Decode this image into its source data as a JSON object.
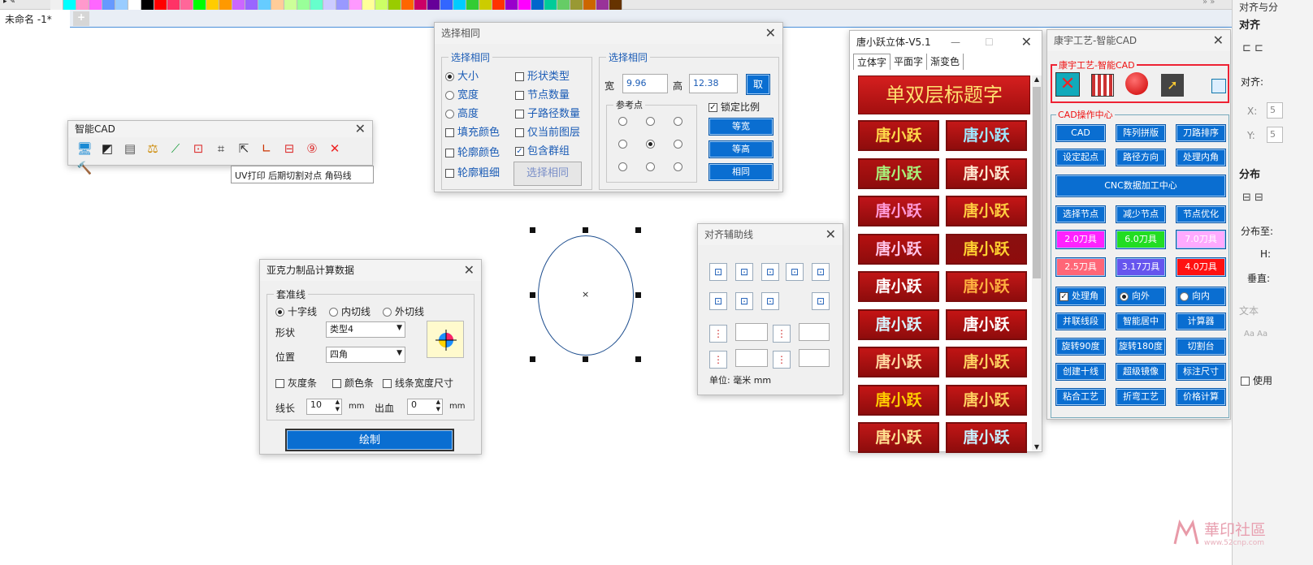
{
  "palette": [
    "#f0f0f0",
    "#00ffff",
    "#ff99cc",
    "#ff66ff",
    "#6699ff",
    "#99ccff",
    "#ffffff",
    "#000000",
    "#ff0000",
    "#ff3366",
    "#ff6699",
    "#00ff00",
    "#ffcc00",
    "#ff9900",
    "#cc66ff",
    "#9966ff",
    "#66ccff",
    "#ffcc99",
    "#ccff99",
    "#99ff99",
    "#66ffcc",
    "#ccccff",
    "#9999ff",
    "#ff99ff",
    "#ffff99",
    "#ccff66",
    "#99cc00",
    "#ff6600",
    "#cc0066",
    "#660099",
    "#3366ff",
    "#00ccff",
    "#33cc33",
    "#cccc00",
    "#ff3300",
    "#9900cc",
    "#ff00ff",
    "#0066cc",
    "#00cc99",
    "#66cc66",
    "#999933",
    "#cc6600",
    "#993399",
    "#663300"
  ],
  "tab": {
    "title": "未命名 -1*",
    "add": "+"
  },
  "smart": {
    "title": "智能CAD",
    "tooltip": "UV打印 后期切割对点 角码线",
    "icons": [
      "monitor-icon",
      "edit-shape-icon",
      "table-icon",
      "scale-icon",
      "node-curve-icon",
      "crop-marks-icon",
      "frame-icon",
      "pointer-icon",
      "corner-icon",
      "split-icon",
      "rotate-90-icon",
      "cross-fill-icon",
      "hammer-icon"
    ]
  },
  "same": {
    "title": "选择相同",
    "group1": "选择相同",
    "col1": [
      "大小",
      "宽度",
      "高度",
      "填充颜色",
      "轮廓颜色",
      "轮廓粗细"
    ],
    "col2": [
      "形状类型",
      "节点数量",
      "子路径数量",
      "仅当前图层",
      "包含群组"
    ],
    "select_btn": "选择相同",
    "group2": "选择相同",
    "w_label": "宽",
    "w": "9.96",
    "h_label": "高",
    "h": "12.38",
    "take": "取",
    "ref": "参考点",
    "lock": "锁定比例",
    "eq_w": "等宽",
    "eq_h": "等高",
    "same": "相同"
  },
  "acrylic": {
    "title": "亚克力制品计算数据",
    "group": "套准线",
    "r1": "十字线",
    "r2": "内切线",
    "r3": "外切线",
    "shape_l": "形状",
    "shape_v": "类型4",
    "pos_l": "位置",
    "pos_v": "四角",
    "c1": "灰度条",
    "c2": "颜色条",
    "c3": "线条宽度尺寸",
    "len_l": "线长",
    "len_v": "10",
    "unit": "mm",
    "bleed_l": "出血",
    "bleed_v": "0",
    "draw": "绘制"
  },
  "align": {
    "title": "对齐辅助线",
    "unit": "单位: 毫米 mm"
  },
  "tang": {
    "title": "唐小跃立体-V5.1",
    "tabs": [
      "立体字",
      "平面字",
      "渐变色"
    ],
    "banner": "单双层标题字",
    "tile": "唐小跃",
    "tiles": [
      [
        "#b81414",
        "#ffd84a"
      ],
      [
        "#c41818",
        "#9fe8ff"
      ],
      [
        "#b01212",
        "#a8f07a"
      ],
      [
        "#c21616",
        "#ffe7d0"
      ],
      [
        "#c0141a",
        "#ff9ad8"
      ],
      [
        "#c41616",
        "#ffcc40"
      ],
      [
        "#b51010",
        "#ffc4e8"
      ],
      [
        "#8a1010",
        "#ffd030"
      ],
      [
        "#c01616",
        "#ffffff"
      ],
      [
        "#c21818",
        "#ffb040"
      ],
      [
        "#c41414",
        "#d8f4ff"
      ],
      [
        "#c41414",
        "#ffffff"
      ],
      [
        "#c41616",
        "#ffd6a0"
      ],
      [
        "#c01414",
        "#ffd060"
      ],
      [
        "#c41616",
        "#ffcc00"
      ],
      [
        "#c41616",
        "#ffd060"
      ],
      [
        "#c01818",
        "#ffe090"
      ],
      [
        "#c01616",
        "#c8f0ff"
      ]
    ]
  },
  "kang": {
    "title": "康宇工艺-智能CAD",
    "sec1": "康宇工艺-智能CAD",
    "sec2": "CAD操作中心",
    "btn_cad": "CAD",
    "btn_tile": "阵列拼版",
    "btn_sort": "刀路排序",
    "r2": [
      "设定起点",
      "路径方向",
      "处理内角"
    ],
    "cnc": "CNC数据加工中心",
    "r3": [
      "选择节点",
      "减少节点",
      "节点优化"
    ],
    "knives": [
      {
        "t": "2.0刀具",
        "bg": "#ff22ff",
        "c": "#fff"
      },
      {
        "t": "6.0刀具",
        "bg": "#22dd22",
        "c": "#fff"
      },
      {
        "t": "7.0刀具",
        "bg": "#ffaaff",
        "c": "#fff"
      },
      {
        "t": "2.5刀具",
        "bg": "#ff6677",
        "c": "#fff"
      },
      {
        "t": "3.17刀具",
        "bg": "#6655ee",
        "c": "#fff"
      },
      {
        "t": "4.0刀具",
        "bg": "#ff1111",
        "c": "#fff"
      }
    ],
    "opt1": "处理角",
    "opt2": "向外",
    "opt3": "向内",
    "rows": [
      [
        "并联线段",
        "智能居中",
        "计算器"
      ],
      [
        "旋转90度",
        "旋转180度",
        "切割台"
      ],
      [
        "创建十线",
        "超级镜像",
        "标注尺寸"
      ],
      [
        "粘合工艺",
        "折弯工艺",
        "价格计算"
      ]
    ]
  },
  "dock": {
    "title": "对齐与分",
    "h1": "对齐",
    "align_l": "对齐:",
    "x": "X:",
    "y": "Y:",
    "x_v": "5",
    "y_v": "5",
    "h2": "分布",
    "dist_l": "分布至:",
    "h_l": "H:",
    "v_l": "垂直:",
    "text": "文本",
    "use": "使用"
  },
  "watermark": {
    "t1": "華印社區",
    "t2": "www.52cnp.com"
  }
}
